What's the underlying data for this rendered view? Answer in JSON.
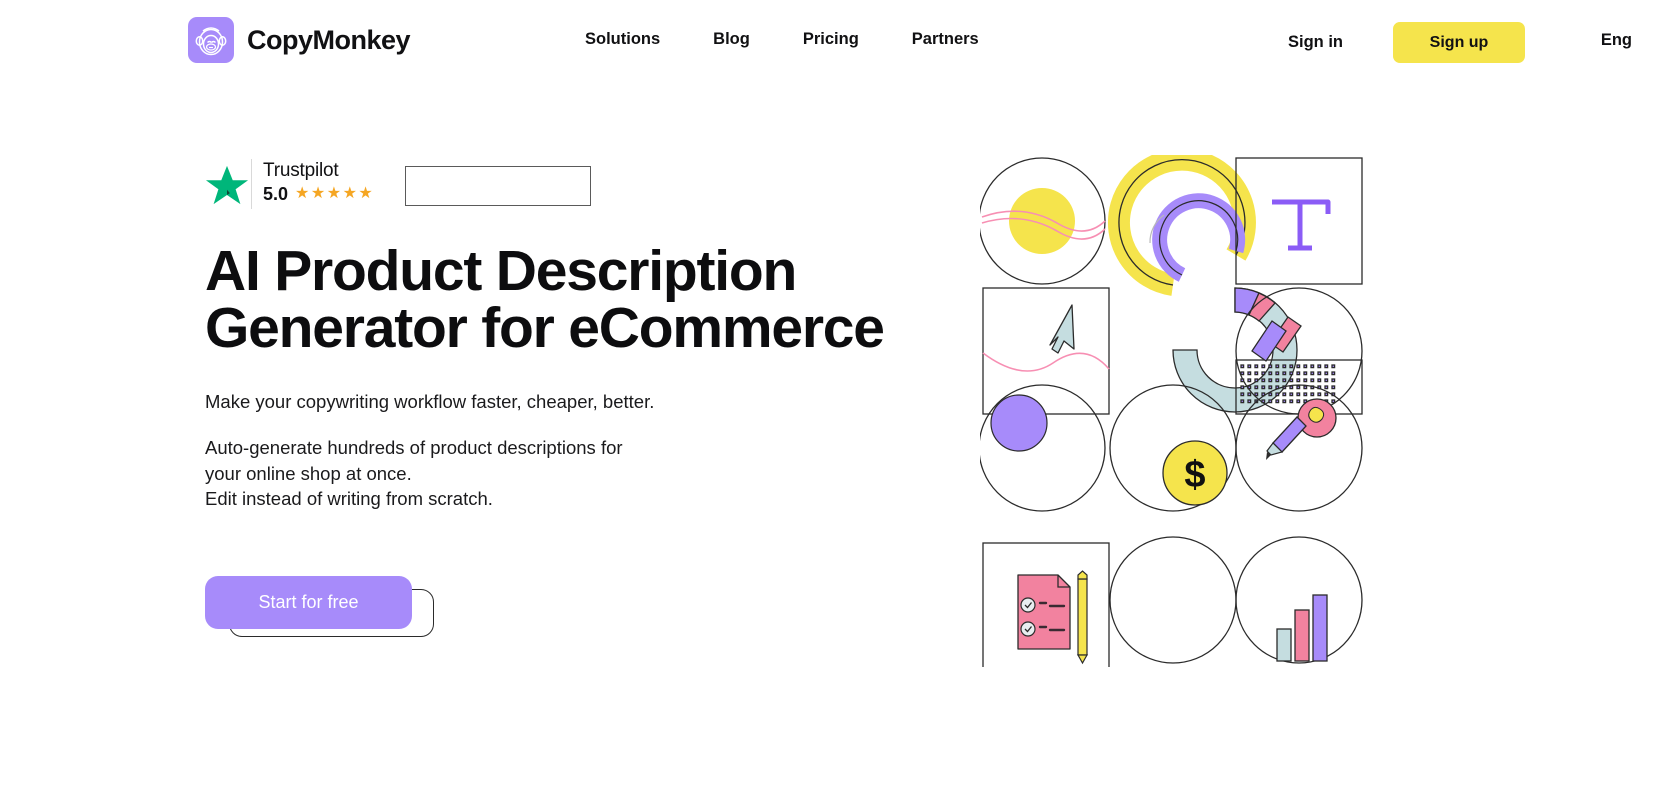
{
  "header": {
    "brand": {
      "name": "CopyMonkey",
      "logo_icon": "monkey-logo-icon",
      "logo_bg": "#a78bfa"
    },
    "nav": [
      {
        "label": "Solutions"
      },
      {
        "label": "Blog"
      },
      {
        "label": "Pricing"
      },
      {
        "label": "Partners"
      }
    ],
    "sign_in": "Sign in",
    "sign_up": "Sign up",
    "sign_up_bg": "#f5e44c",
    "language": "Eng"
  },
  "hero": {
    "trustpilot": {
      "star_icon": "trustpilot-star-icon",
      "star_color": "#00b67a",
      "name": "Trustpilot",
      "score": "5.0",
      "stars": "★★★★★",
      "stars_color": "#f5a623"
    },
    "headline_line1": "AI Product Description",
    "headline_line2": "Generator for eCommerce",
    "subtitle": "Make your copywriting workflow faster, cheaper, better.",
    "paragraph_line1": "Auto-generate hundreds of product descriptions for",
    "paragraph_line2": "your online shop at once.",
    "paragraph_line3": "Edit instead of writing from scratch.",
    "cta_label": "Start for free",
    "cta_bg": "#a78bfa"
  },
  "illustration": {
    "name": "hero-decorative-grid",
    "colors": {
      "yellow": "#f5e44c",
      "purple": "#a78bfa",
      "pink": "#f2829f",
      "teal": "#c5dde0",
      "pink_line": "#f78fb3",
      "outline": "#2b2b2b"
    },
    "items": [
      "circle-with-yellow-dot",
      "yellow-purple-arc-rings",
      "square-with-text-tool-icon",
      "square-with-cursor-arrow",
      "teal-donut-chart",
      "circle-with-dotted-square",
      "circle-with-purple-dot",
      "circle-with-dollar-coin",
      "circle-with-lightbulb-pencil",
      "square-with-checklist-pencil",
      "empty-circle",
      "circle-with-bar-chart"
    ]
  }
}
